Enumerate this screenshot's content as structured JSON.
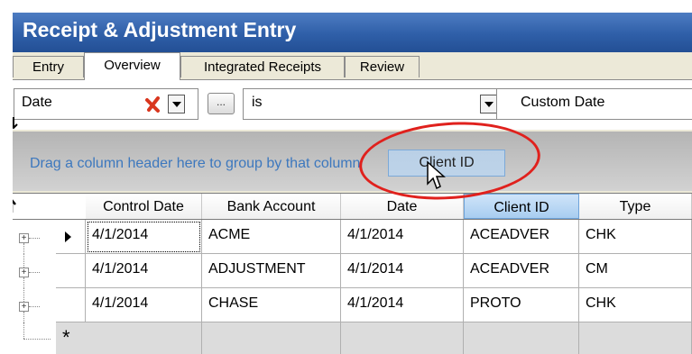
{
  "window": {
    "title": "Receipt & Adjustment Entry"
  },
  "tabs": [
    {
      "label": "Entry",
      "active": false
    },
    {
      "label": "Overview",
      "active": true
    },
    {
      "label": "Integrated Receipts",
      "active": false
    },
    {
      "label": "Review",
      "active": false
    }
  ],
  "filter": {
    "field": "Date",
    "ellipsis_label": "...",
    "operator": "is",
    "value": "Custom Date"
  },
  "group_bar": {
    "hint_visible": "Drag a column header here to group by th",
    "hint_tail": "at column",
    "drag_ghost_label": "Client ID"
  },
  "grid": {
    "columns": [
      "Control Date",
      "Bank Account",
      "Date",
      "Client ID",
      "Type"
    ],
    "selected_column": "Client ID",
    "rows": [
      {
        "control_date": "4/1/2014",
        "bank_account": "ACME",
        "date": "4/1/2014",
        "client_id": "ACEADVER",
        "type": "CHK",
        "current": true
      },
      {
        "control_date": "4/1/2014",
        "bank_account": "ADJUSTMENT",
        "date": "4/1/2014",
        "client_id": "ACEADVER",
        "type": "CM",
        "current": false
      },
      {
        "control_date": "4/1/2014",
        "bank_account": "CHASE",
        "date": "4/1/2014",
        "client_id": "PROTO",
        "type": "CHK",
        "current": false
      }
    ],
    "new_row_symbol": "*",
    "expand_symbol": "+"
  },
  "colors": {
    "title_bar": "#2f5fa8",
    "group_hint_text": "#3d78be",
    "annotation_circle": "#e0211d",
    "remove_x": "#d9361e"
  }
}
